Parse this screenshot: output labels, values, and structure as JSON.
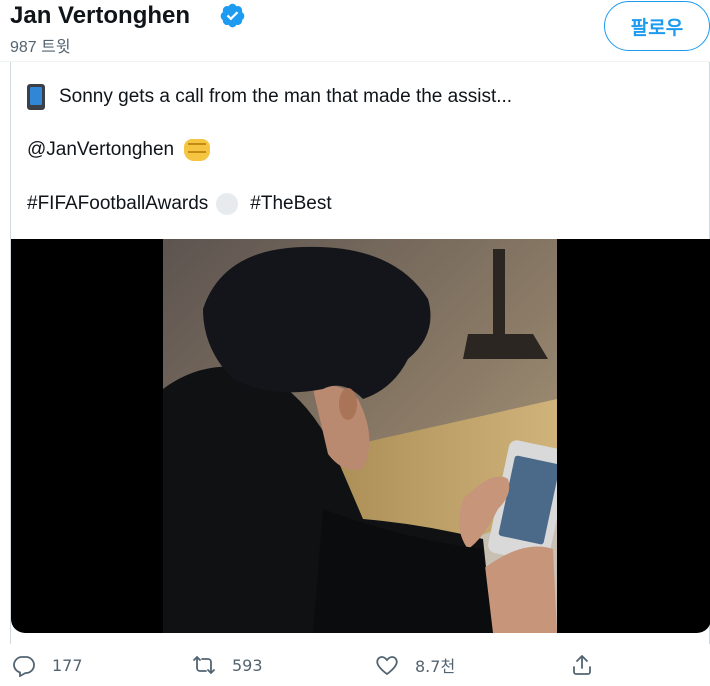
{
  "header": {
    "profile_name": "Jan Vertonghen",
    "tweet_count": "987 트윗",
    "follow_label": "팔로우",
    "verified_color": "#1d9bf0"
  },
  "tweet": {
    "line1_text": "Sonny gets a call from the man that made the assist...",
    "line1_icon": "mobile-phone-icon",
    "mention": "@JanVertonghen",
    "mention_icon": "oncoming-fist-icon",
    "hashtag1": "#FIFAFootballAwards",
    "hashtag_icon": "soccer-ball-icon",
    "hashtag2": "#TheBest"
  },
  "actions": {
    "reply_count": "177",
    "retweet_count": "593",
    "like_count": "8.7천",
    "share_label": ""
  },
  "colors": {
    "accent": "#1d9bf0",
    "text": "#0f1419",
    "secondary": "#536471"
  }
}
